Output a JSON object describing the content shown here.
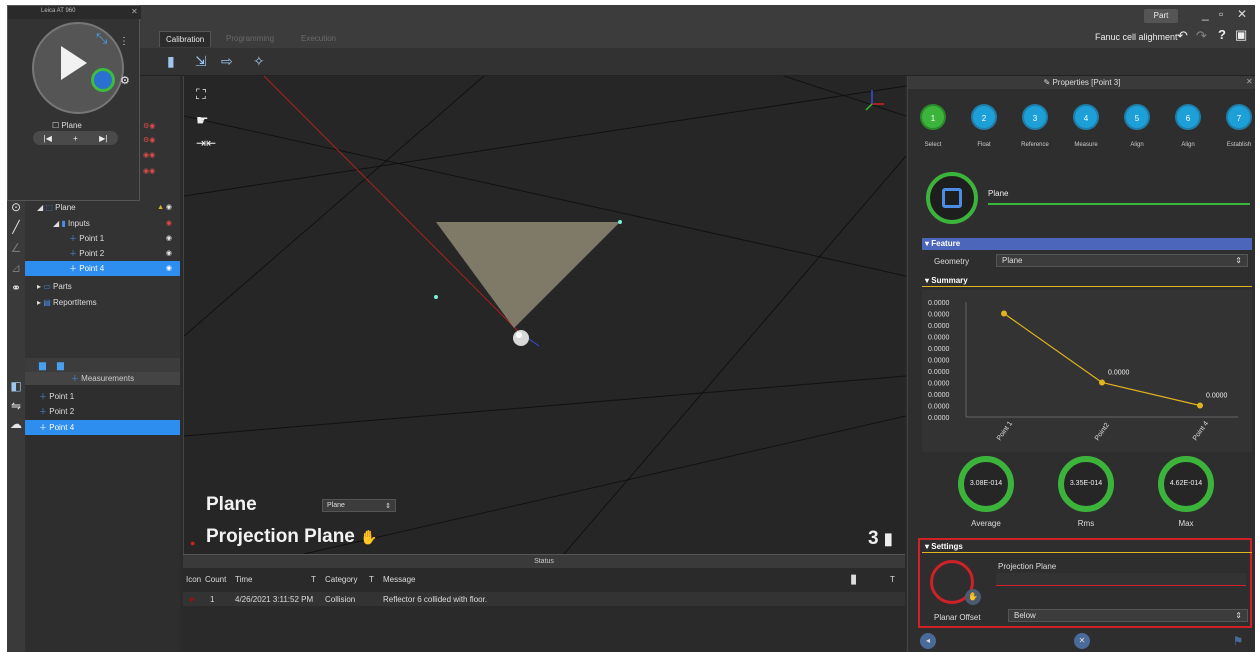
{
  "tracker": {
    "title": "Leica AT 960",
    "plane_label": "Plane",
    "transport": [
      "|◀",
      "+",
      "▶|"
    ]
  },
  "tabs": {
    "calibration": "Calibration",
    "programming": "Programming",
    "execution": "Execution"
  },
  "topbar": {
    "part": "Part",
    "app_title": "Fanuc cell alighment"
  },
  "tree": {
    "plane": "Plane",
    "inputs": "Inputs",
    "points": [
      "Point 1",
      "Point 2",
      "Point 4"
    ],
    "parts": "Parts",
    "report_items": "ReportItems"
  },
  "measurements": {
    "title": "Measurements",
    "items": [
      "Point 1",
      "Point 2",
      "Point 4"
    ]
  },
  "viewport": {
    "title": "Plane",
    "plane_select": "Plane",
    "projection_title": "Projection Plane",
    "count": "3"
  },
  "status": {
    "title": "Status",
    "columns": {
      "icon": "Icon",
      "count": "Count",
      "time": "Time",
      "category": "Category",
      "message": "Message"
    },
    "rows": [
      {
        "count": "1",
        "time": "4/26/2021 3:11:52 PM",
        "category": "Collision",
        "message": "Reflector 6 collided with floor."
      }
    ]
  },
  "properties": {
    "title": "Properties [Point 3]",
    "steps": [
      {
        "num": "1",
        "label": "Select"
      },
      {
        "num": "2",
        "label": "Float"
      },
      {
        "num": "3",
        "label": "Reference"
      },
      {
        "num": "4",
        "label": "Measure"
      },
      {
        "num": "5",
        "label": "Align"
      },
      {
        "num": "6",
        "label": "Align"
      },
      {
        "num": "7",
        "label": "Establish"
      }
    ],
    "feature_name": "Plane",
    "feature_section": "Feature",
    "geometry_label": "Geometry",
    "geometry_value": "Plane",
    "summary_section": "Summary",
    "stats": [
      {
        "value": "3.08E-014",
        "label": "Average"
      },
      {
        "value": "3.35E-014",
        "label": "Rms"
      },
      {
        "value": "4.62E-014",
        "label": "Max"
      }
    ],
    "settings_section": "Settings",
    "projection_plane_label": "Projection Plane",
    "planar_offset_label": "Planar Offset",
    "planar_offset_value": "Below"
  },
  "chart_data": {
    "type": "line",
    "categories": [
      "Point 1",
      "Point2",
      "Point 4"
    ],
    "values": [
      9e-05,
      3e-05,
      1e-05
    ],
    "tick_labels": [
      "0.0000",
      "0.0000",
      "0.0000",
      "0.0000",
      "0.0000",
      "0.0000",
      "0.0000",
      "0.0000",
      "0.0000",
      "0.0000",
      "0.0000"
    ],
    "data_labels": [
      "",
      "0.0000",
      "0.0000"
    ],
    "ylim": [
      0,
      0.0001
    ],
    "color": "#e0b41e"
  }
}
